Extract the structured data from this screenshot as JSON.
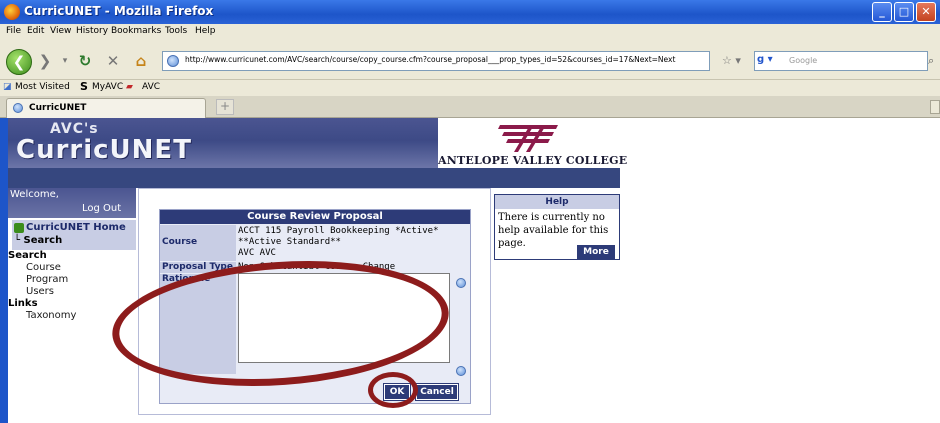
{
  "window": {
    "title": "CurricUNET - Mozilla Firefox"
  },
  "menu": [
    "File",
    "Edit",
    "View",
    "History",
    "Bookmarks",
    "Tools",
    "Help"
  ],
  "url": "http://www.curricunet.com/AVC/search/course/copy_course.cfm?course_proposal___prop_types_id=52&courses_id=17&Next=Next",
  "search_placeholder": "Google",
  "bookmarks": [
    "Most Visited",
    "MyAVC",
    "AVC"
  ],
  "tab": {
    "label": "CurricUNET",
    "new_tab": "+"
  },
  "banner": {
    "avc": "AVC's",
    "title": "CurricUNET",
    "college": "ANTELOPE VALLEY COLLEGE"
  },
  "leftnav": {
    "welcome": "Welcome,",
    "logout": "Log Out",
    "home": "CurricUNET Home",
    "search_link": "Search",
    "search_head": "Search",
    "search_items": [
      "Course",
      "Program",
      "Users"
    ],
    "links_head": "Links",
    "links_items": [
      "Taxonomy"
    ]
  },
  "form": {
    "title": "Course Review Proposal",
    "course_label": "Course",
    "course_line1": "ACCT 115 Payroll Bookkeeping *Active*",
    "course_line2": "**Active Standard**",
    "course_line3": "AVC AVC",
    "proposal_type_label": "Proposal Type",
    "proposal_type_value": "Non-Substantial Course Change",
    "rationale_label": "Rationale",
    "ok": "OK",
    "cancel": "Cancel"
  },
  "help": {
    "title": "Help",
    "text": "There is currently no help available for this page.",
    "more": "More"
  },
  "colors": {
    "nav_dark": "#2d3b78",
    "annotation": "#8d1c1c",
    "xp_title": "#1d55c9"
  }
}
